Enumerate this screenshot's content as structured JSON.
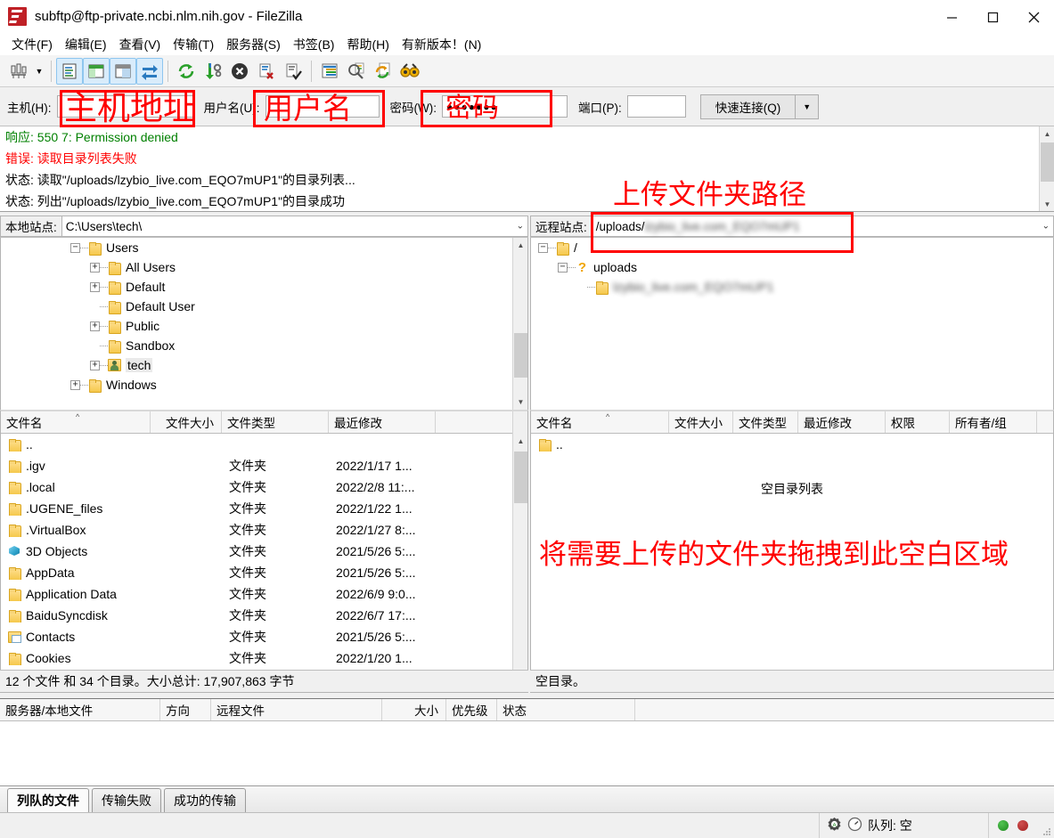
{
  "window": {
    "title": "subftp@ftp-private.ncbi.nlm.nih.gov - FileZilla",
    "minimize": "–",
    "maximize": "□",
    "close": "✕"
  },
  "menu": [
    {
      "label": "文件(F)"
    },
    {
      "label": "编辑(E)"
    },
    {
      "label": "查看(V)"
    },
    {
      "label": "传输(T)"
    },
    {
      "label": "服务器(S)"
    },
    {
      "label": "书签(B)"
    },
    {
      "label": "帮助(H)"
    },
    {
      "label": "有新版本！(N)"
    }
  ],
  "toolbar": {
    "icons": [
      "site-manager-icon",
      "site-manager-dropdown-icon",
      "toggle-message-log-icon",
      "toggle-local-tree-icon",
      "toggle-remote-tree-icon",
      "toggle-transfer-queue-icon",
      "refresh-icon",
      "process-queue-icon",
      "cancel-icon",
      "disconnect-icon",
      "reconnect-icon",
      "filter-icon",
      "compare-directories-icon",
      "synchronized-browsing-icon",
      "find-files-icon"
    ]
  },
  "connection": {
    "host_label": "主机(H):",
    "host_value": "",
    "user_label": "用户名(U):",
    "user_value": "",
    "password_label": "密码(W):",
    "password_value": "●●●●●●●",
    "port_label": "端口(P):",
    "port_value": "",
    "quickconnect_label": "快速连接(Q)",
    "quickconnect_caret": "▼"
  },
  "annotations": {
    "host": "主机地址",
    "username": "用户名",
    "password": "密码",
    "remote_path": "上传文件夹路径",
    "drop_area": "将需要上传的文件夹拖拽到此空白区域",
    "color": "#ff0000"
  },
  "log": {
    "lines": [
      {
        "prefix": "响应:",
        "text": " 550 7: Permission denied",
        "color": "green"
      },
      {
        "prefix": "错误:",
        "text": " 读取目录列表失败",
        "color": "red"
      },
      {
        "prefix": "状态:",
        "text": " 读取\"/uploads/lzybio_live.com_EQO7mUP1\"的目录列表...",
        "color": "black"
      },
      {
        "prefix": "状态:",
        "text": " 列出\"/uploads/lzybio_live.com_EQO7mUP1\"的目录成功",
        "color": "black"
      }
    ]
  },
  "local": {
    "site_label": "本地站点:",
    "path": "C:\\Users\\tech\\",
    "tree": [
      {
        "label": "Users",
        "indent": 0,
        "expander": "−",
        "icon": "folder-icon",
        "selected": false
      },
      {
        "label": "All Users",
        "indent": 1,
        "expander": "+",
        "icon": "folder-icon",
        "selected": false
      },
      {
        "label": "Default",
        "indent": 1,
        "expander": "+",
        "icon": "folder-icon",
        "selected": false
      },
      {
        "label": "Default User",
        "indent": 1,
        "expander": "",
        "icon": "folder-icon",
        "selected": false
      },
      {
        "label": "Public",
        "indent": 1,
        "expander": "+",
        "icon": "folder-icon",
        "selected": false
      },
      {
        "label": "Sandbox",
        "indent": 1,
        "expander": "",
        "icon": "folder-icon",
        "selected": false
      },
      {
        "label": "tech",
        "indent": 1,
        "expander": "+",
        "icon": "user-folder-icon",
        "selected": true
      },
      {
        "label": "Windows",
        "indent": 0,
        "expander": "+",
        "icon": "folder-icon",
        "selected": false
      }
    ],
    "columns": [
      "文件名",
      "文件大小",
      "文件类型",
      "最近修改"
    ],
    "rows": [
      {
        "name": "..",
        "size": "",
        "type": "",
        "modified": "",
        "icon": "folder-icon"
      },
      {
        "name": ".igv",
        "size": "",
        "type": "文件夹",
        "modified": "2022/1/17 1...",
        "icon": "folder-icon"
      },
      {
        "name": ".local",
        "size": "",
        "type": "文件夹",
        "modified": "2022/2/8 11:...",
        "icon": "folder-icon"
      },
      {
        "name": ".UGENE_files",
        "size": "",
        "type": "文件夹",
        "modified": "2022/1/22 1...",
        "icon": "folder-icon"
      },
      {
        "name": ".VirtualBox",
        "size": "",
        "type": "文件夹",
        "modified": "2022/1/27 8:...",
        "icon": "folder-icon"
      },
      {
        "name": "3D Objects",
        "size": "",
        "type": "文件夹",
        "modified": "2021/5/26 5:...",
        "icon": "3d-objects-icon"
      },
      {
        "name": "AppData",
        "size": "",
        "type": "文件夹",
        "modified": "2021/5/26 5:...",
        "icon": "folder-icon"
      },
      {
        "name": "Application Data",
        "size": "",
        "type": "文件夹",
        "modified": "2022/6/9 9:0...",
        "icon": "folder-icon"
      },
      {
        "name": "BaiduSyncdisk",
        "size": "",
        "type": "文件夹",
        "modified": "2022/6/7 17:...",
        "icon": "folder-icon"
      },
      {
        "name": "Contacts",
        "size": "",
        "type": "文件夹",
        "modified": "2021/5/26 5:...",
        "icon": "contacts-folder-icon"
      },
      {
        "name": "Cookies",
        "size": "",
        "type": "文件夹",
        "modified": "2022/1/20 1...",
        "icon": "folder-icon"
      }
    ],
    "status": "12 个文件 和 34 个目录。大小总计: 17,907,863 字节"
  },
  "remote": {
    "site_label": "远程站点:",
    "path": "/uploads/lzybio_live.com_EQO7mUP1",
    "path_visible": "/uploads/",
    "path_redacted": "lzybio_live.com_EQO7mUP1",
    "tree": [
      {
        "label": "/",
        "indent": 0,
        "expander": "−",
        "icon": "folder-icon",
        "redacted": false
      },
      {
        "label": "uploads",
        "indent": 1,
        "expander": "−",
        "icon": "question-folder-icon",
        "redacted": false
      },
      {
        "label": "lzybio_live.com_EQO7mUP1",
        "indent": 2,
        "expander": "",
        "icon": "folder-icon",
        "redacted": true
      }
    ],
    "columns": [
      "文件名",
      "文件大小",
      "文件类型",
      "最近修改",
      "权限",
      "所有者/组"
    ],
    "rows": [
      {
        "name": "..",
        "size": "",
        "type": "",
        "modified": "",
        "perm": "",
        "owner": "",
        "icon": "folder-icon"
      }
    ],
    "empty_note": "空目录列表",
    "status": "空目录。"
  },
  "queue": {
    "columns": [
      "服务器/本地文件",
      "方向",
      "远程文件",
      "大小",
      "优先级",
      "状态"
    ],
    "tabs": [
      {
        "label": "列队的文件",
        "active": true
      },
      {
        "label": "传输失败",
        "active": false
      },
      {
        "label": "成功的传输",
        "active": false
      }
    ]
  },
  "statusbar": {
    "queue_text": "队列: 空",
    "icons": [
      "encryption-icon",
      "speed-icon"
    ],
    "led_green": "#1f8a1f",
    "led_red": "#a32020"
  }
}
